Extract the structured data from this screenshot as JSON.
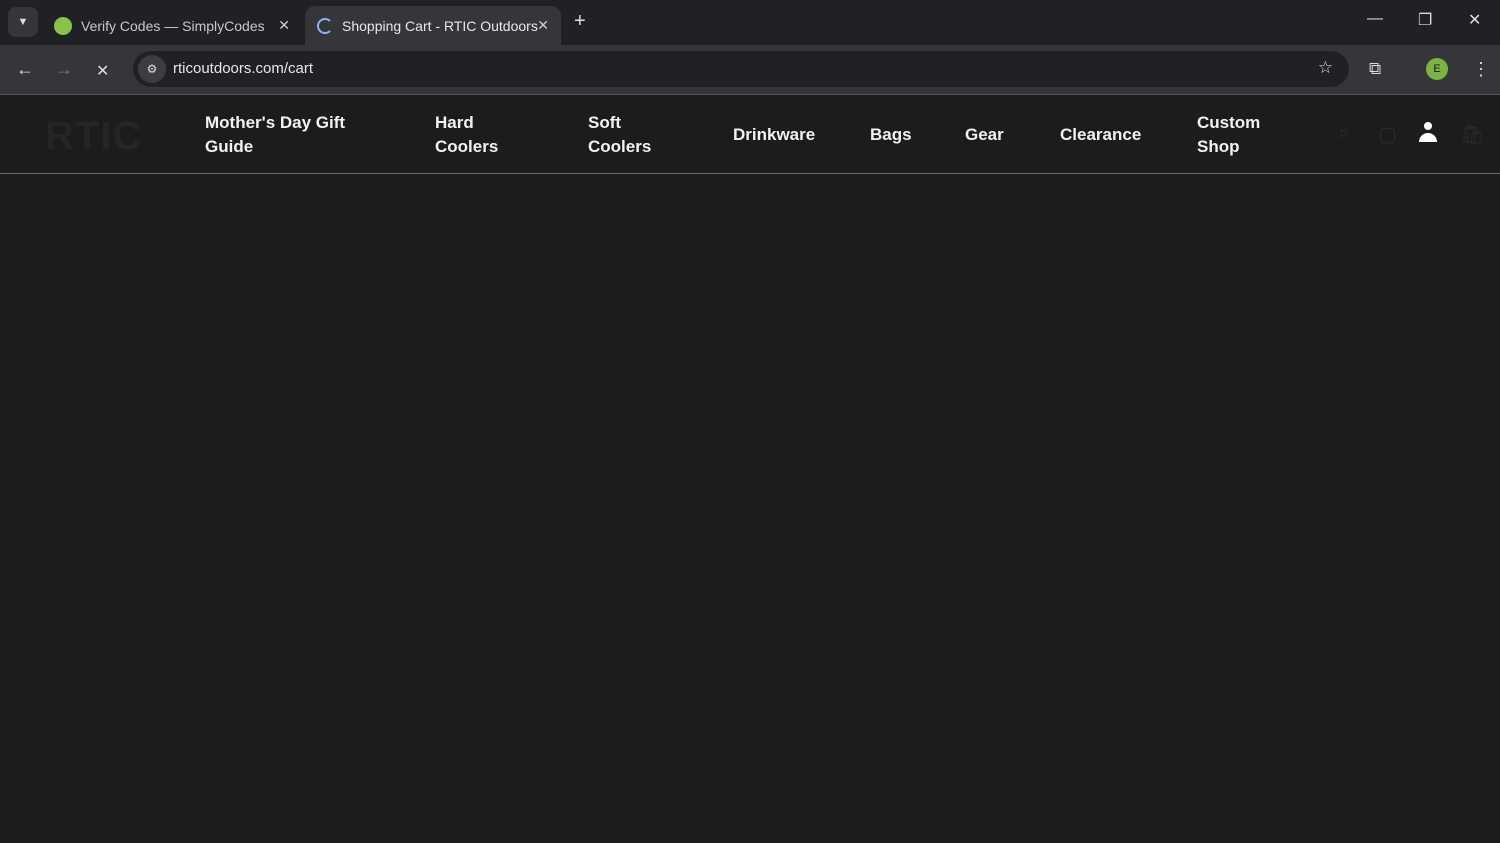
{
  "browser": {
    "tabs": [
      {
        "title": "Verify Codes — SimplyCodes",
        "active": false
      },
      {
        "title": "Shopping Cart - RTIC Outdoors",
        "active": true
      }
    ],
    "url": "rticoutdoors.com/cart",
    "profile_initial": "E",
    "accent": "#7cb342"
  },
  "site": {
    "logo": "RTIC",
    "nav": [
      {
        "line1": "Mother's Day Gift",
        "line2": "Guide"
      },
      {
        "line1": "Hard",
        "line2": "Coolers"
      },
      {
        "line1": "Soft",
        "line2": "Coolers"
      },
      {
        "line1": "Drinkware",
        "line2": ""
      },
      {
        "line1": "Bags",
        "line2": ""
      },
      {
        "line1": "Gear",
        "line2": ""
      },
      {
        "line1": "Clearance",
        "line2": ""
      },
      {
        "line1": "Custom",
        "line2": "Shop"
      }
    ]
  }
}
